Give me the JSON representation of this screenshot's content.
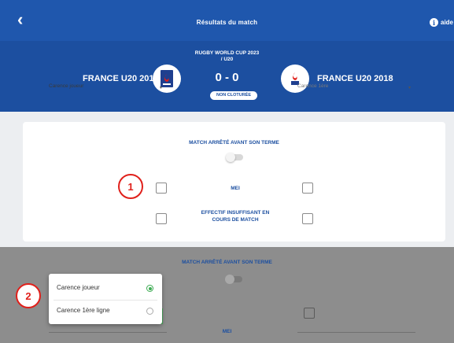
{
  "header": {
    "back_icon": "chevron-left-icon",
    "title": "Résultats du match",
    "help_icon": "info-icon",
    "help_label": "aide"
  },
  "match": {
    "competition": "RUGBY WORLD CUP 2023",
    "category": "/ U20",
    "home_team": "FRANCE U20 2019",
    "away_team": "FRANCE U20 2018",
    "score": "0 - 0",
    "status": "NON CLOTURÉE"
  },
  "card": {
    "title": "MATCH ARRÊTÉ AVANT SON TERME",
    "row1_label": "MEI",
    "row2_label_line1": "EFFECTIF INSUFFISANT EN",
    "row2_label_line2": "COURS DE MATCH"
  },
  "markers": {
    "one": "1",
    "two": "2"
  },
  "lower": {
    "title": "MATCH ARRÊTÉ AVANT SON TERME",
    "mei_label": "MEI",
    "select_value": "Carence joueur",
    "select_right_value": "Carence 1ère"
  },
  "dropdown": {
    "options": [
      {
        "label": "Carence joueur",
        "selected": true
      },
      {
        "label": "Carence 1ère ligne",
        "selected": false
      }
    ]
  },
  "colors": {
    "header_blue": "#1f57ad",
    "match_blue": "#1c4fa0",
    "marker_red": "#e0201b",
    "radio_green": "#3cab52"
  }
}
